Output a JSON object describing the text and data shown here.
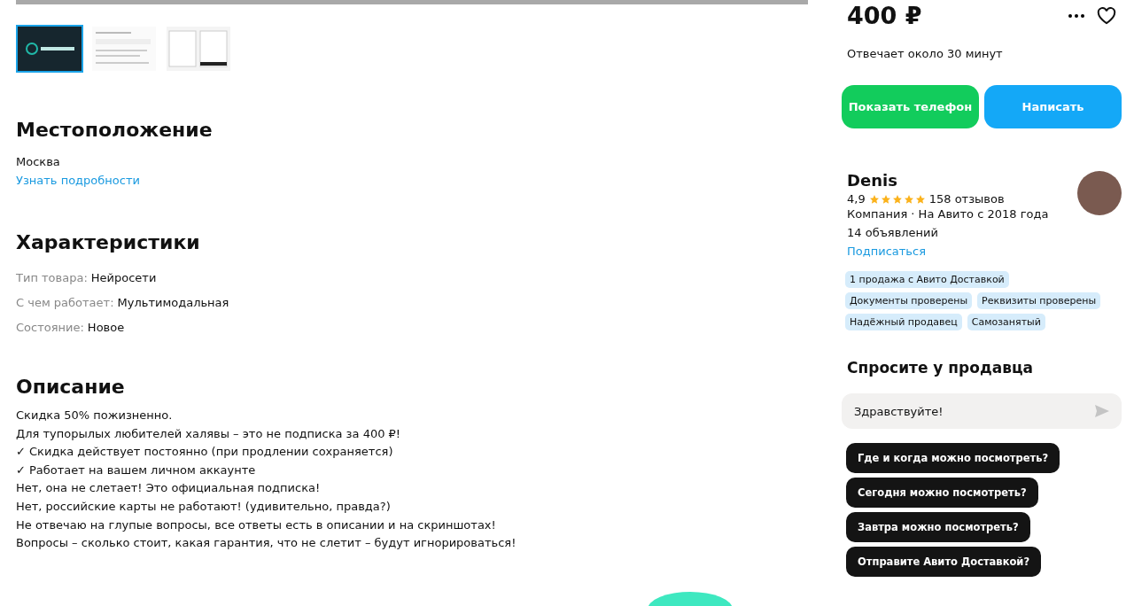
{
  "gallery": {
    "thumbnails": [
      {
        "selected": true,
        "kind": "logo"
      },
      {
        "selected": false,
        "kind": "document"
      },
      {
        "selected": false,
        "kind": "form"
      }
    ]
  },
  "location": {
    "title": "Местоположение",
    "city": "Москва",
    "link": "Узнать подробности"
  },
  "specs": {
    "title": "Характеристики",
    "rows": [
      {
        "label": "Тип товара:",
        "value": "Нейросети"
      },
      {
        "label": "С чем работает:",
        "value": "Мультимодальная"
      },
      {
        "label": "Состояние:",
        "value": "Новое"
      }
    ]
  },
  "description": {
    "title": "Описание",
    "lines": [
      "Скидка 50% пожизненно.",
      "Для тупорылых любителей халявы – это не подписка за 400 ₽!",
      "✓ Скидка действует постоянно (при продлении сохраняется)",
      "✓ Работает на вашем личном аккаунте",
      "Нет, она не слетает! Это официальная подписка!",
      "Нет, российские карты не работают! (удивительно, правда?)",
      "Не отвечаю на глупые вопросы, все ответы есть в описании и на скриншотах!",
      "Вопросы – сколько стоит, какая гарантия, что не слетит – будут игнорироваться!"
    ]
  },
  "price": "400 ₽",
  "response_time": "Отвечает около 30 минут",
  "buttons": [
    {
      "label": "Показать телефон",
      "kind": "phone"
    },
    {
      "label": "Написать",
      "kind": "message"
    }
  ],
  "seller": {
    "name": "Denis",
    "rating": "4,9",
    "stars": 5,
    "reviews": "158 отзывов",
    "info": "Компания · На Авито с 2018 года",
    "listings": "14 объявлений",
    "subscribe": "Подписаться",
    "badges": [
      "1 продажа с Авито Доставкой",
      "Документы проверены",
      "Реквизиты проверены",
      "Надёжный продавец",
      "Самозанятый"
    ]
  },
  "ask": {
    "title": "Спросите у продавца",
    "message": "Здравствуйте!",
    "questions": [
      "Где и когда можно посмотреть?",
      "Сегодня можно посмотреть?",
      "Завтра можно посмотреть?",
      "Отправите Авито Доставкой?"
    ]
  }
}
